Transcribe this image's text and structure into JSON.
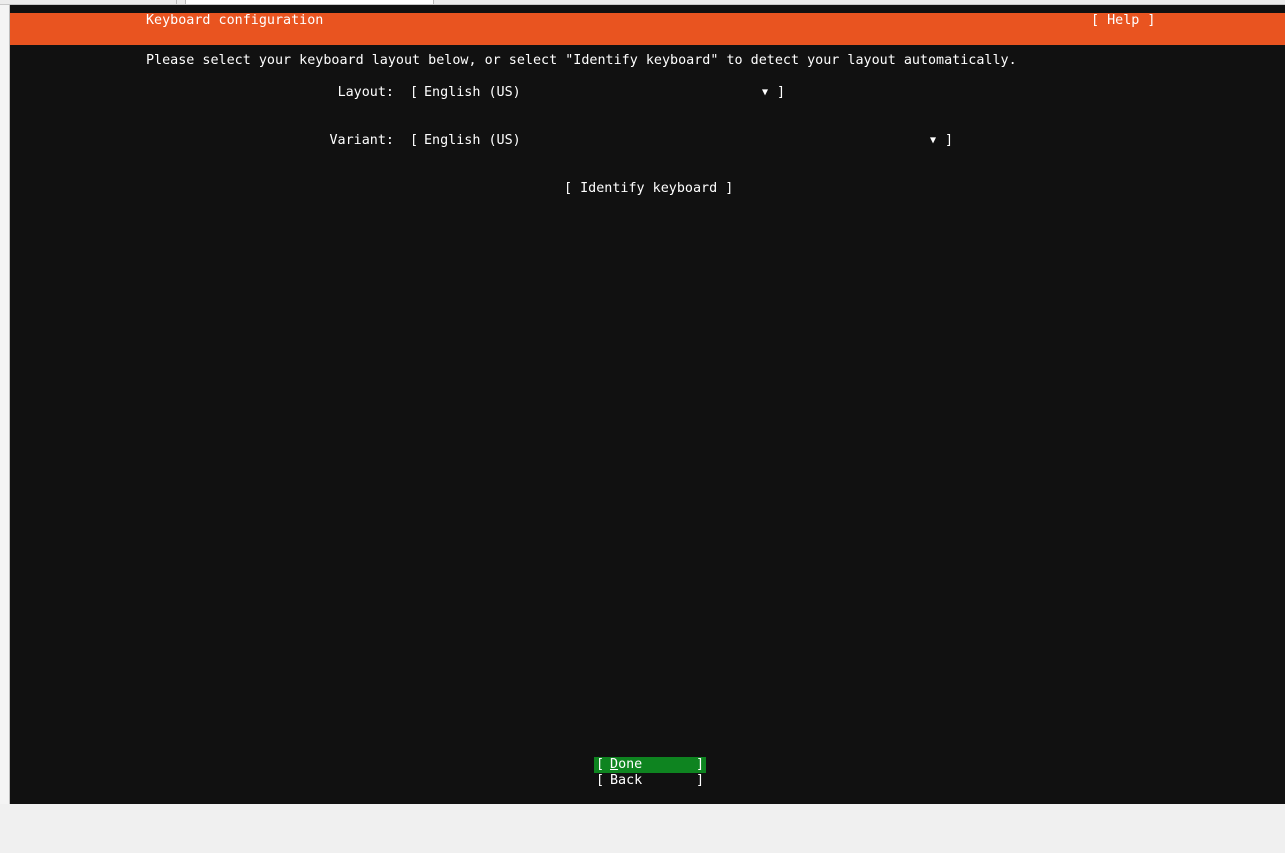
{
  "header": {
    "title": "Keyboard configuration",
    "help_label": "[ Help ]"
  },
  "instructions": "Please select your keyboard layout below, or select \"Identify keyboard\" to detect your layout automatically.",
  "form": {
    "layout": {
      "label": "Layout:",
      "value": "English (US)"
    },
    "variant": {
      "label": "Variant:",
      "value": "English (US)"
    },
    "select_open_bracket": "[",
    "select_close_bracket": "]",
    "dropdown_arrow": "▼"
  },
  "identify_button": "[ Identify keyboard ]",
  "actions": {
    "open_bracket": "[",
    "close_bracket": "]",
    "done": {
      "mnemonic": "D",
      "rest": "one"
    },
    "back": {
      "label": "Back"
    }
  },
  "colors": {
    "header": "#e95420",
    "background": "#111111",
    "text": "#ffffff",
    "focused_button": "#0e8420"
  }
}
